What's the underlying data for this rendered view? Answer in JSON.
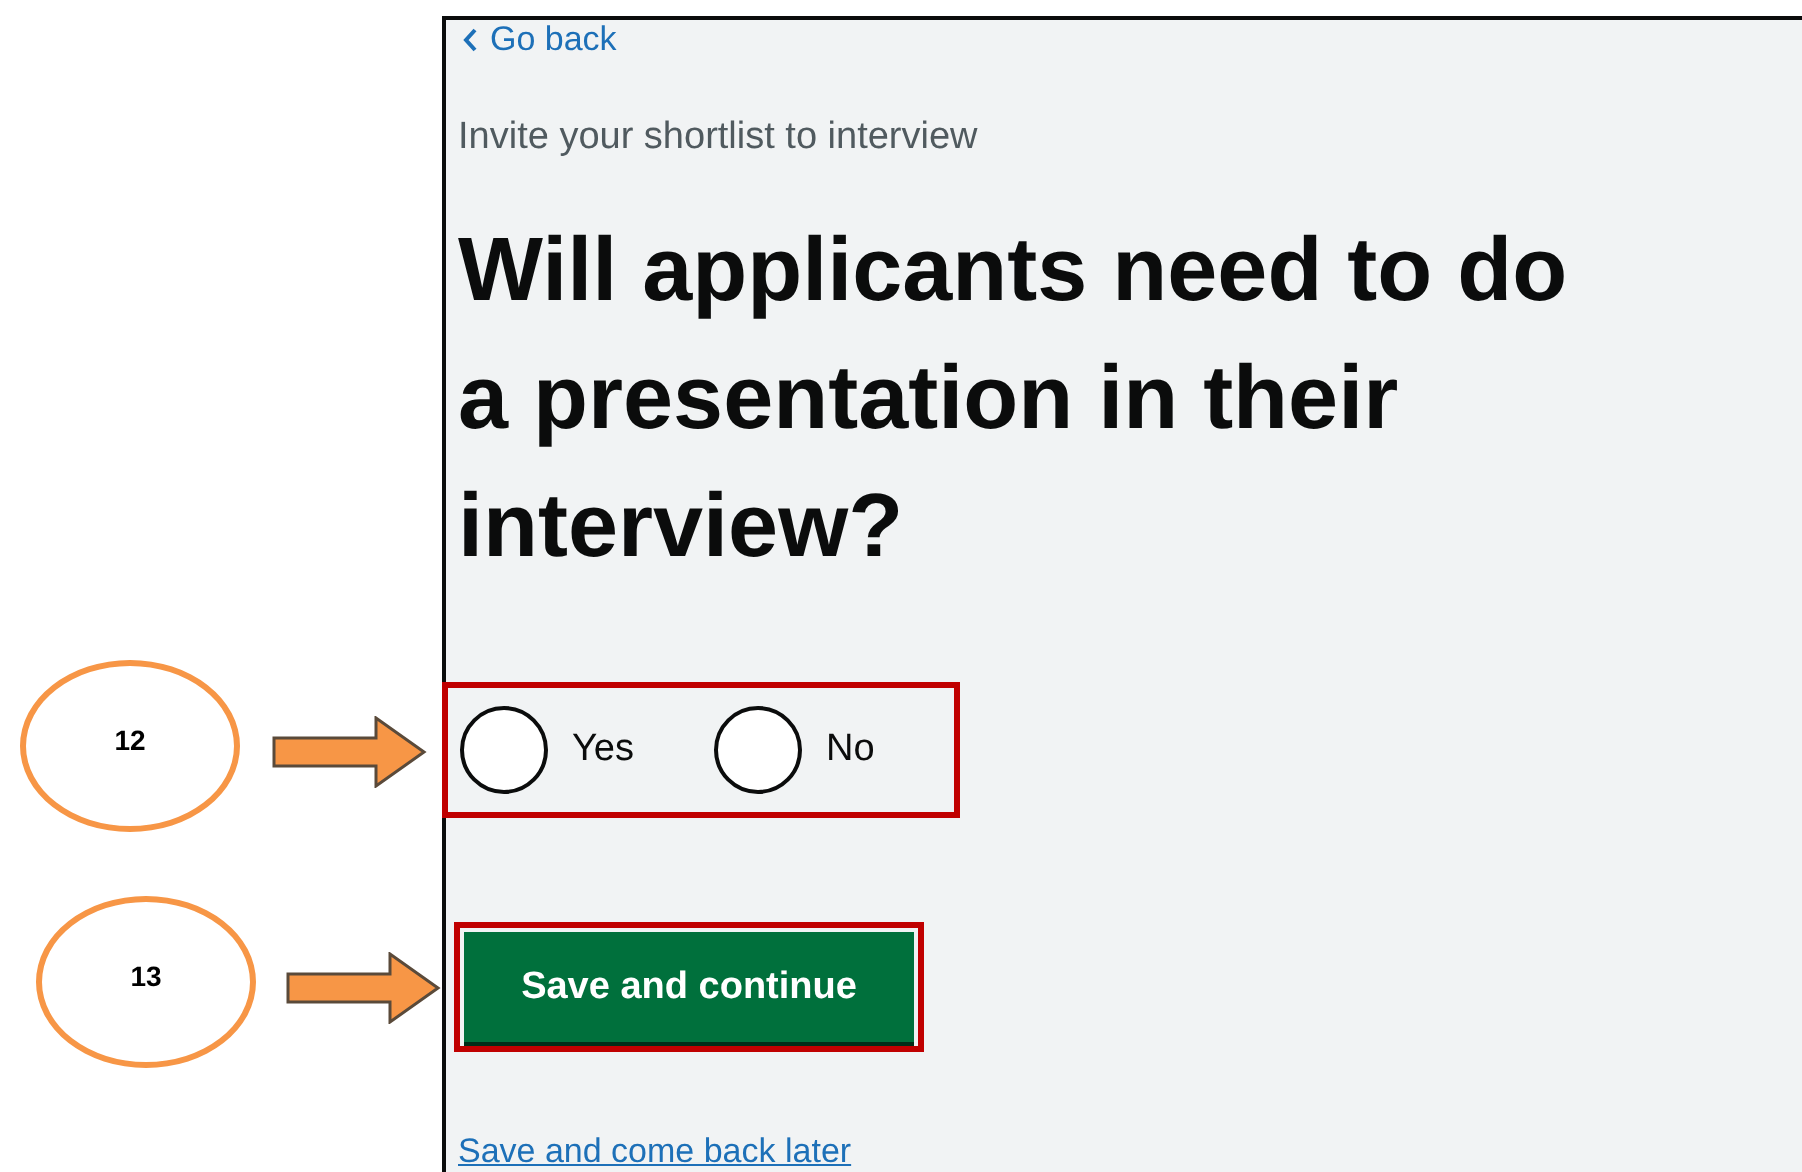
{
  "back_link": {
    "label": "Go back"
  },
  "caption": "Invite your shortlist to interview",
  "heading": "Will applicants need to do a presentation in their interview?",
  "question": {
    "options": [
      {
        "label": "Yes",
        "selected": false
      },
      {
        "label": "No",
        "selected": false
      }
    ]
  },
  "primary_button": "Save and continue",
  "secondary_link": "Save and come back later",
  "annotations": [
    {
      "number": "12"
    },
    {
      "number": "13"
    }
  ]
}
